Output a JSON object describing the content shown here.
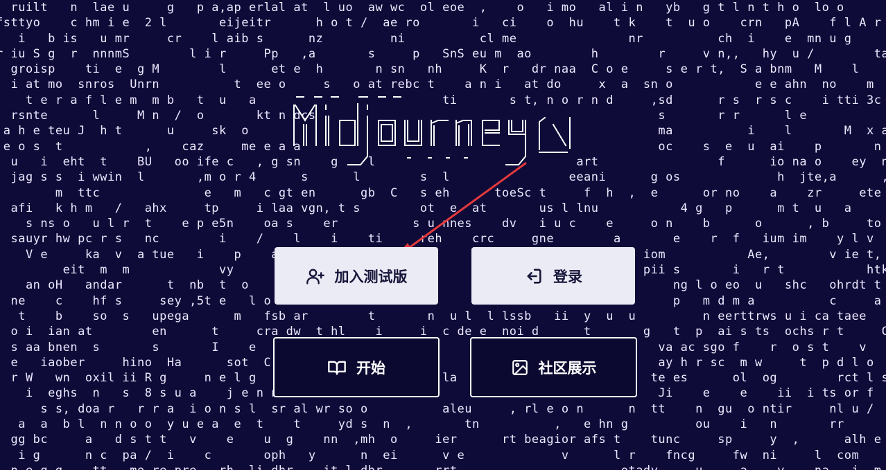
{
  "background_lines": [
    "  ruilt   n  lae u     g   p a,ap erlal at  l uo  aw wc  ol eoe  ,    o   i mo   al i n   yb   g t l n t h o  lo o",
    "fsttyo    c hm i e  2 l       eijeitr      h o t /  ae ro       i   ci    o  hu    t k    t  u o    crn   pA    f l A r  lea",
    "   i   b is   u mr     cr    l aib s      nz         ni          cl me               nr          ch  i    e  mn u g       as d w  k",
    "r iu S g  r  nnnmS        l i r     Pp   ,a       s     p   SnS eu m  ao        h        r     v n,,   hy  u /        ta       ears",
    "  groisp    ti  e  g M        l      et e  h       n sn   nh     K  r   dr naa  C o e     s e r t,  S a bnm   M    l        hm pi",
    "  i at mo  snros  Unrn          t  ee o     s   o at rebc t    a n i   at do     x  a  sn o           e e ahn  no    m   fi amy",
    "    t e r a f l e m  m b   t  u   a                         ti       s t, n o r n d     ,sd      r s  r s c    i tti 3c",
    "  rsnte      l     M n  /  o       kt n dcs                                              s       r r      l e            s or Ha",
    " a h e teu J  h t      u     sk  o                                                       ma          i    l       M  x a en ilnt",
    " e o s  t           ,    caz     me e a a                                                oc    s  e  u  ai    p       n l pn he",
    "  u   i  eht  t    BU   oo ife c   , g sn    g    l                           art                f      io na o    ey  n / t g",
    "  jag s s  i wwin  l       ,m o r 4      s      l        s  l                eeani      g os             h  jte,a      ,      pc",
    "        m  ttc              e   m   c gt en      gb  C   s eh      toeSc t     f  h  ,  e      or no    a    zr     ete        a snta o",
    "  afi   k h m   /   ahx     tp     i laa vgn, t s        ot  e  at       us l lnu           4 g   p      m t  u   a      Jp t m   h",
    "    s ns o   u l r  t    e p e5n    oa s    er          s u nnes    dv   i u c    e     o n    b      o      , b     to  aa n i c s",
    "  sauyr hw pc r s   nc        i    /    l    i    ti     reh    crc     gne        a       e    r  f   ium im    y l v      c spth   i",
    "    V e     ka  v  a tue   i    p    at     eutt ct  c            e iS k  n  o  v  i   iom           Ae,        v ie t,    dn",
    "         eit  m  m            vy      s                         y,et                   pii s       i   r t           htk     yes",
    "    an oH   andar      t  nb  t  o      s                                                  ng l o eo  u   shc   ohrdt t",
    "  ne    c    hf s     sey ,5t e   l o f                         rtin                       p   m d m a          c     a",
    "   t    b    so  s   upega      m   fsb ar        t       n  u l  l lssb   ii  y  u  u         n eerttrws u i ca taee     wrt  a",
    "  o i  ian at        en      t     cra dw  t hl    i     i  c de e  noi d      t       g   t  p  ai s ts  ochs r t     Cp      et  s gpat",
    "  s aa bnen  s       s       I    e    o   i l                   sn                      va ac sgo f    r  o s t    v     i,",
    "  e   iaober     hino  Ha      sot  C                                                    ay h r sc  m w     t  p d l o  a r",
    "  r W   wn  oxil ii R g     n e l g                         la                          te es      ol  og        rct l s g",
    "    i  eghs  n   s  8 s u a    j e n n i                                                 Ji    e    e    ii  i ts or f",
    "      s s, doa r   r r a  i o n s l  sr al wr so o          aleu     , rl e o n      n  tt    n  gu  o ntir     nl u /  w      tt s i i",
    "   a  a  b l  n n o o  y u e a  e  t    t     yd s  n  ,       tn          ,   e hn g         ou    i   n       rr      uy/e   sl  n f",
    "  gg bc     a   d s t t   v    e    u  g    nn  ,mh  o     ier      rt beagior afs t    tunc     sp     y  ,      alh e  u  r  ra t i r  i  m e",
    "   i g      n c  pa /  i    c       oph   y      n  ei      v e             v      l r    fncg     fw  ni     l  com      ib  e  m  a  de r",
    "  n e g g    tt   mo re pre   rh  li dhr    it l dhr       rrt                      otady     u     a    y    na   i  m    a   e  rg eo"
  ],
  "buttons": {
    "join_beta": "加入测试版",
    "login": "登录",
    "start": "开始",
    "showcase": "社区展示"
  },
  "icons": {
    "join_beta": "user-plus-icon",
    "login": "log-in-icon",
    "start": "open-book-icon",
    "showcase": "image-icon"
  },
  "colors": {
    "background": "#0e0b38",
    "text": "#ece8ff",
    "button_light": "#ebebf5",
    "button_dark": "#0b0930",
    "annotation_arrow": "#e3393c"
  }
}
